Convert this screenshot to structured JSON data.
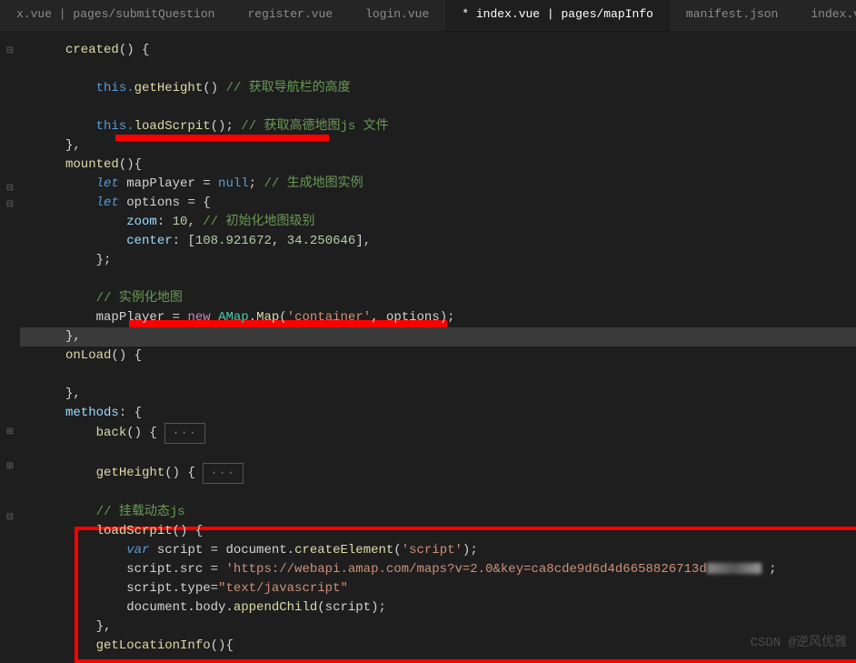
{
  "tabs": [
    {
      "label": "x.vue | pages/submitQuestion",
      "active": false
    },
    {
      "label": "register.vue",
      "active": false
    },
    {
      "label": "login.vue",
      "active": false
    },
    {
      "label": "* index.vue | pages/mapInfo",
      "active": true
    },
    {
      "label": "manifest.json",
      "active": false
    },
    {
      "label": "index.vue | pag",
      "active": false
    }
  ],
  "code": {
    "l1": {
      "method": "created",
      "brace": "() {"
    },
    "l2_prefix": "this.",
    "l2_method": "getHeight",
    "l2_call": "()",
    "l2_comment": " // 获取导航栏的高度",
    "l3_prefix": "this.",
    "l3_method": "loadScrpit",
    "l3_call": "();",
    "l3_comment": " // 获取高德地图js 文件",
    "l4": "},",
    "l5_method": "mounted",
    "l5_brace": "(){",
    "l6_kw": "let",
    "l6_var": " mapPlayer = ",
    "l6_null": "null",
    "l6_semi": ";",
    "l6_comment": " // 生成地图实例",
    "l7_kw": "let",
    "l7_var": " options = {",
    "l8_prop": "zoom",
    "l8_colon": ": ",
    "l8_num": "10",
    "l8_comma": ",",
    "l8_comment": " // 初始化地图级别",
    "l9_prop": "center",
    "l9_colon": ": [",
    "l9_n1": "108.921672",
    "l9_c1": ", ",
    "l9_n2": "34.250646",
    "l9_end": "],",
    "l10": "};",
    "l11_comment": "// 实例化地图",
    "l12_var": "mapPlayer = ",
    "l12_new": "new",
    "l12_sp": " ",
    "l12_amap": "AMap",
    "l12_dot1": ".",
    "l12_map": "Map",
    "l12_open": "(",
    "l12_str": "'container'",
    "l12_c": ", options);",
    "l13": "},",
    "l14_method": "onLoad",
    "l14_brace": "() {",
    "l15": "},",
    "l16_prop": "methods",
    "l16_brace": ": {",
    "l17_method": "back",
    "l17_brace": "() {",
    "l17_dots": "···",
    "l18_method": "getHeight",
    "l18_brace": "() {",
    "l18_dots": "···",
    "l19_comment": "// 挂载动态js",
    "l20_method": "loadScrpit",
    "l20_brace": "() {",
    "l21_kw": "var",
    "l21_var": " script = document.",
    "l21_method": "createElement",
    "l21_open": "(",
    "l21_str": "'script'",
    "l21_end": ");",
    "l22_var": "script.src = ",
    "l22_str": "'https://webapi.amap.com/maps?v=2.0&key=ca8cde9d6d4d6658826713d",
    "l22_end": " ;",
    "l23_var": "script.type=",
    "l23_str": "\"text/javascript\"",
    "l24_var": "document.body.",
    "l24_method": "appendChild",
    "l24_open": "(script);",
    "l25": "},",
    "l26_method": "getLocationInfo",
    "l26_brace": "(){"
  },
  "watermark": "CSDN @逆风优雅"
}
